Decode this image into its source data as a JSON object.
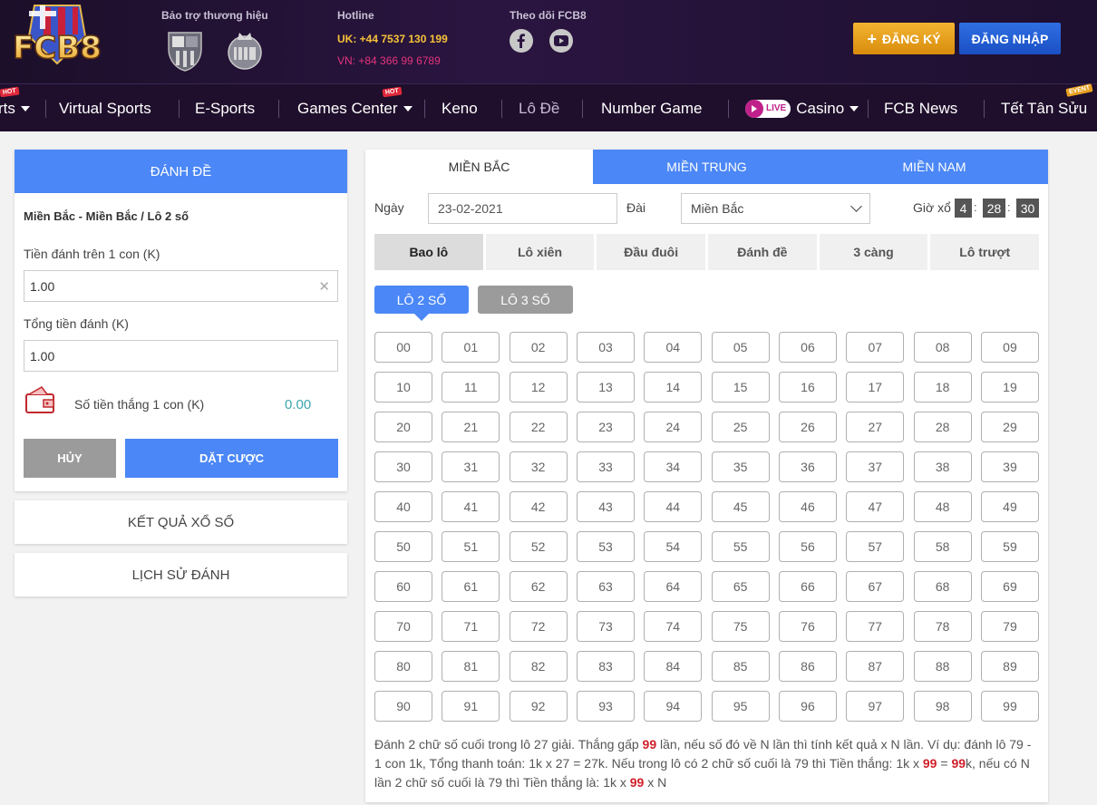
{
  "brand": {
    "logo_text": "FCB8"
  },
  "header": {
    "sponsor_title": "Bảo trợ thương hiệu",
    "hotline_title": "Hotline",
    "hotline_uk": "UK: +44 7537 130 199",
    "hotline_vn": "VN: +84 366 99 6789",
    "follow_title": "Theo dõi FCB8",
    "register_label": "ĐĂNG KÝ",
    "login_label": "ĐĂNG NHẬP"
  },
  "nav": {
    "items": [
      {
        "label": "rts",
        "badge": "HOT"
      },
      {
        "label": "Virtual Sports"
      },
      {
        "label": "E-Sports"
      },
      {
        "label": "Games Center",
        "badge": "HOT"
      },
      {
        "label": "Keno"
      },
      {
        "label": "Lô Đề"
      },
      {
        "label": "Number Game"
      },
      {
        "label": "Casino",
        "live": "LIVE"
      },
      {
        "label": "FCB News"
      },
      {
        "label": "Tết Tân Sửu",
        "badge": "EVENT"
      }
    ]
  },
  "bet_panel": {
    "title": "ĐÁNH ĐỀ",
    "subtitle": "Miền Bắc - Miền Bắc / Lô 2 số",
    "stake_label": "Tiền đánh trên 1 con (K)",
    "stake_value": "1.00",
    "total_label": "Tổng tiền đánh (K)",
    "total_value": "1.00",
    "win_label": "Số tiền thắng 1 con (K)",
    "win_value": "0.00",
    "cancel_label": "HỦY",
    "place_label": "DẶT CƯỢC"
  },
  "side_links": {
    "results": "KẾT QUẢ XỔ SỐ",
    "history": "LỊCH SỬ ĐÁNH"
  },
  "region_tabs": [
    "MIỀN BẮC",
    "MIỀN TRUNG",
    "MIỀN NAM"
  ],
  "filters": {
    "date_label": "Ngày",
    "date_value": "23-02-2021",
    "station_label": "Đài",
    "station_value": "Miền Bắc",
    "draw_label": "Giờ xổ",
    "hh": "4",
    "mm": "28",
    "ss": "30"
  },
  "type_tabs": [
    "Bao lô",
    "Lô xiên",
    "Đầu đuôi",
    "Đánh đề",
    "3 càng",
    "Lô trượt"
  ],
  "sub_tabs": [
    "LÔ 2 SỐ",
    "LÔ 3 SỐ"
  ],
  "numbers": [
    [
      "00",
      "01",
      "02",
      "03",
      "04",
      "05",
      "06",
      "07",
      "08",
      "09"
    ],
    [
      "10",
      "11",
      "12",
      "13",
      "14",
      "15",
      "16",
      "17",
      "18",
      "19"
    ],
    [
      "20",
      "21",
      "22",
      "23",
      "24",
      "25",
      "26",
      "27",
      "28",
      "29"
    ],
    [
      "30",
      "31",
      "32",
      "33",
      "34",
      "35",
      "36",
      "37",
      "38",
      "39"
    ],
    [
      "40",
      "41",
      "42",
      "43",
      "44",
      "45",
      "46",
      "47",
      "48",
      "49"
    ],
    [
      "50",
      "51",
      "52",
      "53",
      "54",
      "55",
      "56",
      "57",
      "58",
      "59"
    ],
    [
      "60",
      "61",
      "62",
      "63",
      "64",
      "65",
      "66",
      "67",
      "68",
      "69"
    ],
    [
      "70",
      "71",
      "72",
      "73",
      "74",
      "75",
      "76",
      "77",
      "78",
      "79"
    ],
    [
      "80",
      "81",
      "82",
      "83",
      "84",
      "85",
      "86",
      "87",
      "88",
      "89"
    ],
    [
      "90",
      "91",
      "92",
      "93",
      "94",
      "95",
      "96",
      "97",
      "98",
      "99"
    ]
  ],
  "note": {
    "p1": "Đánh 2 chữ số cuối trong lô 27 giải. Thắng gấp ",
    "m1": "99",
    "p2": " lần, nếu số đó về N lần thì tính kết quả x N lần. Ví dụ: đánh lô 79 - 1 con 1k, Tổng thanh toán: 1k x 27 = 27k. Nếu trong lô có 2 chữ số cuối là 79 thì Tiền thắng: 1k x ",
    "m2": "99",
    "p3": " = ",
    "m3": "99",
    "p4": "k, nếu có N lần 2 chữ số cuối là 79 thì Tiền thắng là: 1k x ",
    "m4": "99",
    "p5": " x N"
  },
  "colors": {
    "accent": "#4b87f6",
    "header_bg": "#1f0f2c",
    "highlight": "#d0202a"
  }
}
